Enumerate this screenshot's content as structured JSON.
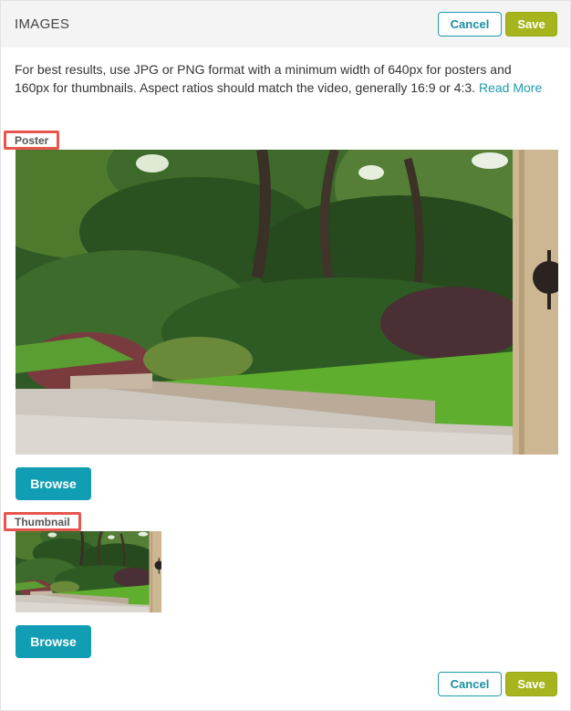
{
  "header": {
    "title": "IMAGES",
    "cancel_label": "Cancel",
    "save_label": "Save"
  },
  "description": {
    "text": "For best results, use JPG or PNG format with a minimum width of 640px for posters and 160px for thumbnails. Aspect ratios should match the video, generally 16:9 or 4:3. ",
    "link_label": "Read More"
  },
  "poster": {
    "label": "Poster",
    "browse_label": "Browse"
  },
  "thumbnail": {
    "label": "Thumbnail",
    "browse_label": "Browse"
  },
  "footer": {
    "cancel_label": "Cancel",
    "save_label": "Save"
  },
  "colors": {
    "accent_teal": "#119db3",
    "save_green": "#a6b51d",
    "highlight_red": "#e8554e"
  }
}
